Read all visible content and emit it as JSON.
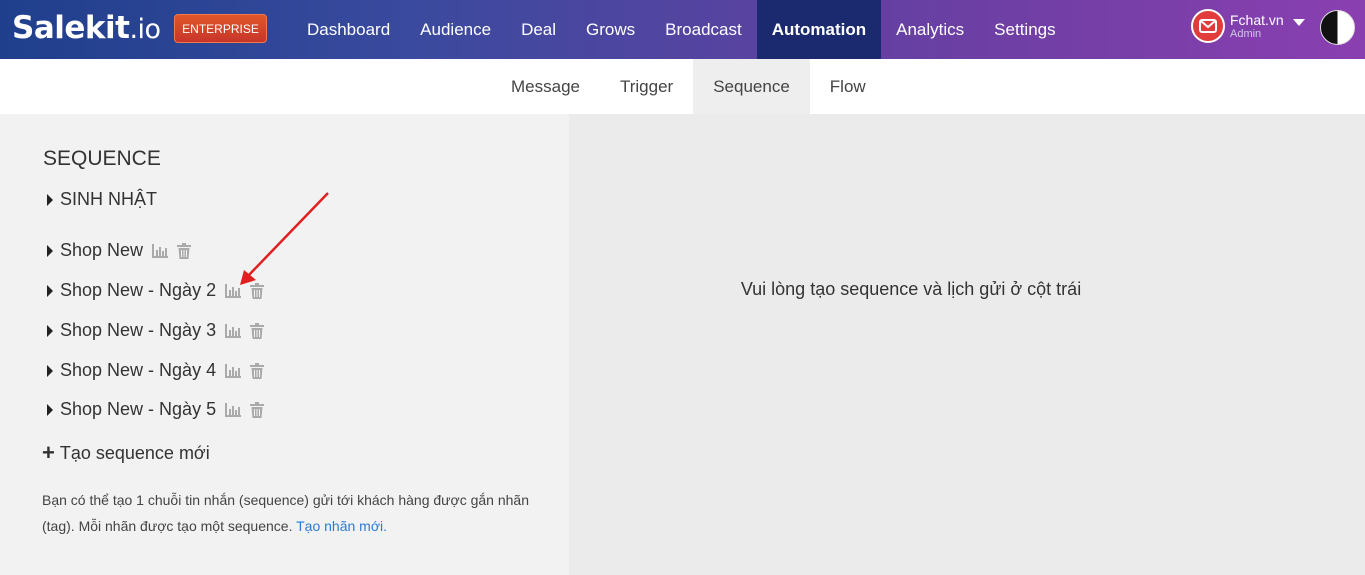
{
  "brand": {
    "logo_main": "Salekit",
    "logo_suffix": ".io",
    "plan_badge": "ENTERPRISE"
  },
  "nav": {
    "items": [
      {
        "label": "Dashboard"
      },
      {
        "label": "Audience"
      },
      {
        "label": "Deal"
      },
      {
        "label": "Grows"
      },
      {
        "label": "Broadcast"
      },
      {
        "label": "Automation",
        "active": true
      },
      {
        "label": "Analytics"
      },
      {
        "label": "Settings"
      }
    ]
  },
  "user": {
    "name": "Fchat.vn",
    "role": "Admin"
  },
  "subnav": {
    "tabs": [
      {
        "label": "Message"
      },
      {
        "label": "Trigger"
      },
      {
        "label": "Sequence",
        "active": true
      },
      {
        "label": "Flow"
      }
    ]
  },
  "sequence_panel": {
    "heading": "SEQUENCE",
    "group_label": "SINH NHẬT",
    "items": [
      {
        "label": "Shop New"
      },
      {
        "label": "Shop New - Ngày 2"
      },
      {
        "label": "Shop New - Ngày 3"
      },
      {
        "label": "Shop New - Ngày 4"
      },
      {
        "label": "Shop New - Ngày 5"
      }
    ],
    "create_label": "Tạo sequence mới",
    "help_text": "Bạn có thể tạo 1 chuỗi tin nhắn (sequence) gửi tới khách hàng được gắn nhãn (tag). Mỗi nhãn được tạo một sequence.",
    "help_link": "Tạo nhãn mới."
  },
  "main": {
    "empty_message": "Vui lòng tạo sequence và lịch gửi ở cột trái"
  },
  "colors": {
    "accent_link": "#2b7bd6",
    "active_nav_bg": "#1b2a6e",
    "annotation_arrow": "#e02020"
  },
  "icons": {
    "stats": "bar-chart-icon",
    "delete": "trash-icon",
    "expand": "caret-right-icon"
  }
}
